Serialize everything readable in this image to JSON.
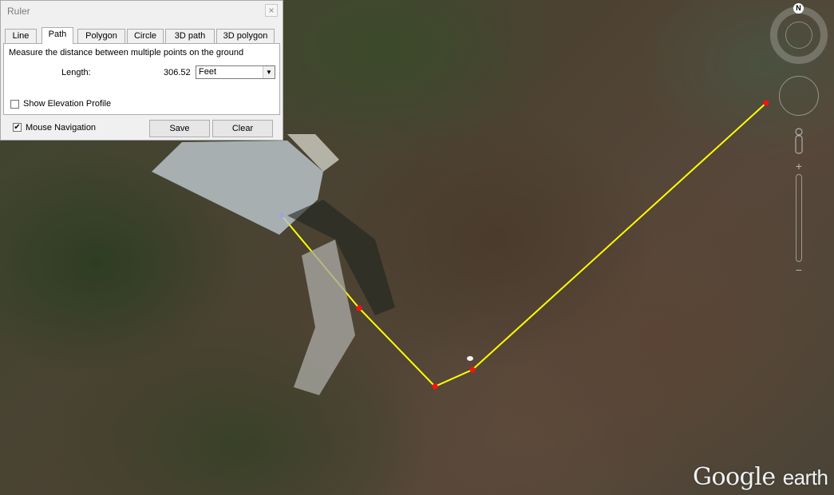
{
  "ruler": {
    "title": "Ruler",
    "close_glyph": "×",
    "tabs": [
      "Line",
      "Path",
      "Polygon",
      "Circle",
      "3D path",
      "3D polygon"
    ],
    "active_tab": "Path",
    "description": "Measure the distance between multiple points on the ground",
    "length_label": "Length:",
    "length_value": "306.52",
    "unit": "Feet",
    "show_elevation_label": "Show Elevation Profile",
    "show_elevation_checked": false,
    "mouse_nav_label": "Mouse Navigation",
    "mouse_nav_checked": true,
    "save_label": "Save",
    "clear_label": "Clear"
  },
  "navigation": {
    "north_label": "N",
    "icons": [
      "compass-ring-icon",
      "look-joystick-icon",
      "street-view-person-icon",
      "zoom-slider-icon"
    ]
  },
  "map": {
    "path_color": "#ffff00",
    "start_point_color": "#1010ff",
    "vertex_color": "#ff1010"
  },
  "brand": {
    "logo_text": "Google",
    "logo_suffix": "earth"
  }
}
